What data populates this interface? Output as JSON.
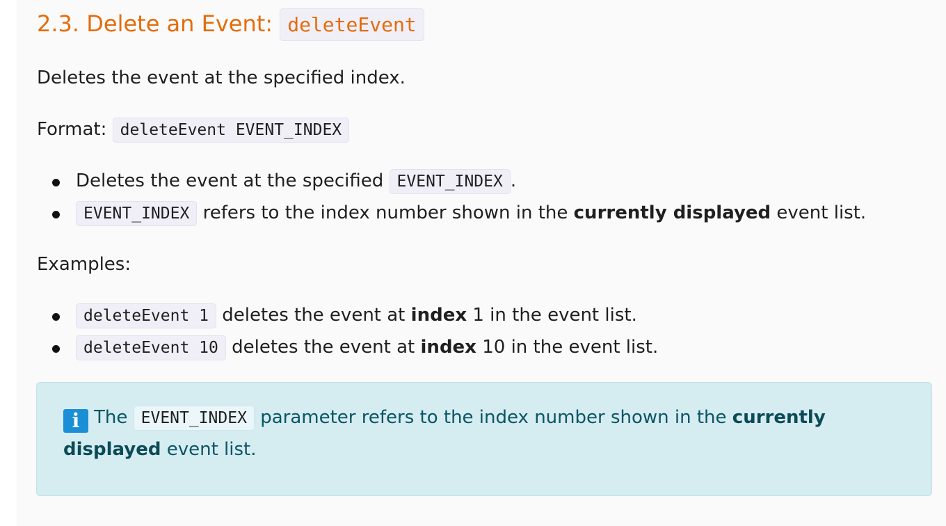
{
  "heading": {
    "number_title": "2.3. Delete an Event:",
    "command": "deleteEvent"
  },
  "description": "Deletes the event at the specified index.",
  "format": {
    "label": "Format:",
    "syntax": "deleteEvent EVENT_INDEX"
  },
  "details": [
    {
      "before": "Deletes the event at the specified",
      "code": "EVENT_INDEX",
      "after": "."
    },
    {
      "code": "EVENT_INDEX",
      "before_bold": "refers to the index number shown in the",
      "bold": "currently displayed",
      "after": "event list."
    }
  ],
  "examples": {
    "label": "Examples:",
    "items": [
      {
        "code": "deleteEvent 1",
        "before_bold": "deletes the event at",
        "bold": "index",
        "after": "1 in the event list."
      },
      {
        "code": "deleteEvent 10",
        "before_bold": "deletes the event at",
        "bold": "index",
        "after": "10 in the event list."
      }
    ]
  },
  "callout": {
    "icon": "info-icon",
    "icon_glyph": "i",
    "lead": "The",
    "code": "EVENT_INDEX",
    "text": "parameter refers to the index number shown in the",
    "bold": "currently displayed",
    "tail": "event list."
  },
  "colors": {
    "heading": "#e46c0a",
    "callout_bg": "#d5ecf1",
    "callout_text": "#0b5563",
    "info_icon": "#1a8fd6"
  }
}
